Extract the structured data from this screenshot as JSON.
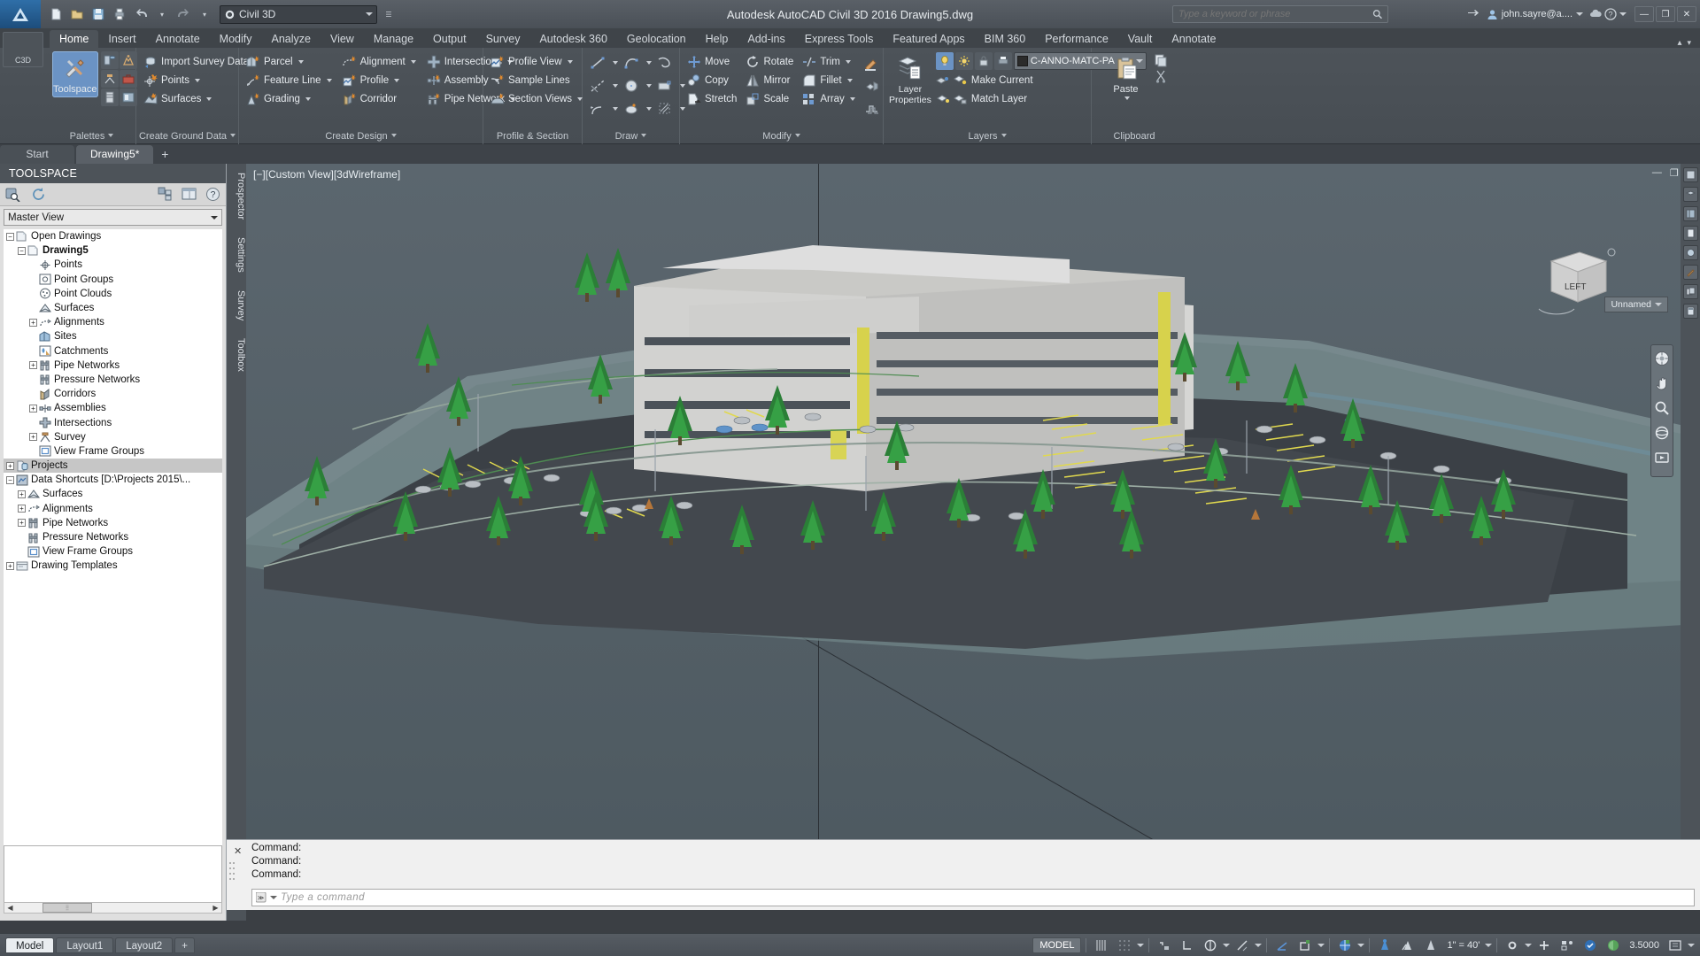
{
  "titlebar": {
    "workspace": "Civil 3D",
    "title": "Autodesk AutoCAD Civil 3D 2016    Drawing5.dwg",
    "search_placeholder": "Type a keyword or phrase",
    "account": "john.sayre@a....",
    "quick_access": [
      "new-icon",
      "open-icon",
      "save-icon",
      "plot-icon",
      "undo-icon",
      "redo-icon"
    ],
    "window_buttons": [
      "minimize",
      "restore",
      "close"
    ]
  },
  "ribbon_tabs": [
    {
      "label": "Home",
      "active": true
    },
    {
      "label": "Insert",
      "active": false
    },
    {
      "label": "Annotate",
      "active": false
    },
    {
      "label": "Modify",
      "active": false
    },
    {
      "label": "Analyze",
      "active": false
    },
    {
      "label": "View",
      "active": false
    },
    {
      "label": "Manage",
      "active": false
    },
    {
      "label": "Output",
      "active": false
    },
    {
      "label": "Survey",
      "active": false
    },
    {
      "label": "Autodesk 360",
      "active": false
    },
    {
      "label": "Geolocation",
      "active": false
    },
    {
      "label": "Help",
      "active": false
    },
    {
      "label": "Add-ins",
      "active": false
    },
    {
      "label": "Express Tools",
      "active": false
    },
    {
      "label": "Featured Apps",
      "active": false
    },
    {
      "label": "BIM 360",
      "active": false
    },
    {
      "label": "Performance",
      "active": false
    },
    {
      "label": "Vault",
      "active": false
    },
    {
      "label": "Annotate",
      "active": false
    }
  ],
  "panels": {
    "palettes": {
      "title": "Palettes",
      "toolspace": "Toolspace"
    },
    "create_ground_data": {
      "title": "Create Ground Data",
      "items": [
        {
          "label": "Import Survey Data",
          "icon": "import-survey-data-icon",
          "dropdown": false
        },
        {
          "label": "Points",
          "icon": "points-icon",
          "dropdown": true
        },
        {
          "label": "Surfaces",
          "icon": "surfaces-icon",
          "dropdown": true
        }
      ]
    },
    "create_design": {
      "title": "Create Design",
      "col1": [
        {
          "label": "Parcel",
          "icon": "parcel-icon",
          "dropdown": true
        },
        {
          "label": "Feature Line",
          "icon": "feature-line-icon",
          "dropdown": true
        },
        {
          "label": "Grading",
          "icon": "grading-icon",
          "dropdown": true
        }
      ],
      "col2": [
        {
          "label": "Alignment",
          "icon": "alignment-icon",
          "dropdown": true
        },
        {
          "label": "Profile",
          "icon": "profile-icon",
          "dropdown": true
        },
        {
          "label": "Corridor",
          "icon": "corridor-icon",
          "dropdown": false
        }
      ],
      "col3": [
        {
          "label": "Intersections",
          "icon": "intersections-icon",
          "dropdown": true
        },
        {
          "label": "Assembly",
          "icon": "assembly-icon",
          "dropdown": true
        },
        {
          "label": "Pipe Network",
          "icon": "pipe-network-icon",
          "dropdown": true
        }
      ]
    },
    "profile_section_views": {
      "title": "Profile & Section Views",
      "items": [
        {
          "label": "Profile View",
          "icon": "profile-view-icon",
          "dropdown": true
        },
        {
          "label": "Sample Lines",
          "icon": "sample-lines-icon",
          "dropdown": false
        },
        {
          "label": "Section Views",
          "icon": "section-views-icon",
          "dropdown": true
        }
      ]
    },
    "draw": {
      "title": "Draw",
      "tools": [
        "line-icon",
        "arc-icon",
        "polyline-icon",
        "spline-icon",
        "circle-icon",
        "rectangle-icon",
        "curve-icon",
        "ellipse-icon",
        "hatch-icon"
      ]
    },
    "modify": {
      "title": "Modify",
      "items": [
        {
          "label": "Move",
          "icon": "move-icon"
        },
        {
          "label": "Rotate",
          "icon": "rotate-icon"
        },
        {
          "label": "Trim",
          "icon": "trim-icon",
          "dropdown": true
        },
        {
          "label": "Copy",
          "icon": "copy-icon"
        },
        {
          "label": "Mirror",
          "icon": "mirror-icon"
        },
        {
          "label": "Fillet",
          "icon": "fillet-icon",
          "dropdown": true
        },
        {
          "label": "Stretch",
          "icon": "stretch-icon"
        },
        {
          "label": "Scale",
          "icon": "scale-icon"
        },
        {
          "label": "Array",
          "icon": "array-icon",
          "dropdown": true
        }
      ],
      "extra_icons": [
        "explode-icon",
        "solid-edit-icon",
        "offset-icon"
      ]
    },
    "layers": {
      "title": "Layers",
      "layer_properties": "Layer\nProperties",
      "layer_properties_label": "Layer Properties",
      "current_layer": "C-ANNO-MATC-PA",
      "layer_color": "#2b2b2b",
      "make_current": "Make Current",
      "match_layer": "Match Layer"
    },
    "clipboard": {
      "title": "Clipboard",
      "paste": "Paste"
    }
  },
  "file_tabs": [
    {
      "label": "Start",
      "active": false
    },
    {
      "label": "Drawing5*",
      "active": true
    }
  ],
  "toolspace": {
    "header": "TOOLSPACE",
    "view_selector": "Master View",
    "toolbar_icons": [
      "search-icon",
      "refresh-icon",
      "panel-layout-icon",
      "panel-preview-icon",
      "help-icon"
    ],
    "tree": [
      {
        "label": "Open Drawings",
        "depth": 0,
        "expander": "minus",
        "icon": "folder-icon",
        "bold": false,
        "selected": false
      },
      {
        "label": "Drawing5",
        "depth": 1,
        "expander": "minus",
        "icon": "drawing-icon",
        "bold": true,
        "selected": false
      },
      {
        "label": "Points",
        "depth": 2,
        "expander": "none",
        "icon": "points-node-icon",
        "bold": false,
        "selected": false
      },
      {
        "label": "Point Groups",
        "depth": 2,
        "expander": "none",
        "icon": "point-groups-icon",
        "bold": false,
        "selected": false
      },
      {
        "label": "Point Clouds",
        "depth": 2,
        "expander": "none",
        "icon": "point-clouds-icon",
        "bold": false,
        "selected": false
      },
      {
        "label": "Surfaces",
        "depth": 2,
        "expander": "none",
        "icon": "surfaces-node-icon",
        "bold": false,
        "selected": false
      },
      {
        "label": "Alignments",
        "depth": 2,
        "expander": "plus",
        "icon": "alignments-node-icon",
        "bold": false,
        "selected": false
      },
      {
        "label": "Sites",
        "depth": 2,
        "expander": "none",
        "icon": "sites-icon",
        "bold": false,
        "selected": false
      },
      {
        "label": "Catchments",
        "depth": 2,
        "expander": "none",
        "icon": "catchments-icon",
        "bold": false,
        "selected": false
      },
      {
        "label": "Pipe Networks",
        "depth": 2,
        "expander": "plus",
        "icon": "pipe-networks-icon",
        "bold": false,
        "selected": false
      },
      {
        "label": "Pressure Networks",
        "depth": 2,
        "expander": "none",
        "icon": "pressure-networks-icon",
        "bold": false,
        "selected": false
      },
      {
        "label": "Corridors",
        "depth": 2,
        "expander": "none",
        "icon": "corridors-icon",
        "bold": false,
        "selected": false
      },
      {
        "label": "Assemblies",
        "depth": 2,
        "expander": "plus",
        "icon": "assemblies-icon",
        "bold": false,
        "selected": false
      },
      {
        "label": "Intersections",
        "depth": 2,
        "expander": "none",
        "icon": "intersections-node-icon",
        "bold": false,
        "selected": false
      },
      {
        "label": "Survey",
        "depth": 2,
        "expander": "plus",
        "icon": "survey-icon",
        "bold": false,
        "selected": false
      },
      {
        "label": "View Frame Groups",
        "depth": 2,
        "expander": "none",
        "icon": "view-frame-groups-icon",
        "bold": false,
        "selected": false
      },
      {
        "label": "Projects",
        "depth": 0,
        "expander": "plus",
        "icon": "projects-icon",
        "bold": false,
        "selected": true
      },
      {
        "label": "Data Shortcuts [D:\\Projects 2015\\...",
        "depth": 0,
        "expander": "minus",
        "icon": "data-shortcuts-icon",
        "bold": false,
        "selected": false
      },
      {
        "label": "Surfaces",
        "depth": 1,
        "expander": "plus",
        "icon": "surfaces-node-icon",
        "bold": false,
        "selected": false
      },
      {
        "label": "Alignments",
        "depth": 1,
        "expander": "plus",
        "icon": "alignments-node-icon",
        "bold": false,
        "selected": false
      },
      {
        "label": "Pipe Networks",
        "depth": 1,
        "expander": "plus",
        "icon": "pipe-networks-icon",
        "bold": false,
        "selected": false
      },
      {
        "label": "Pressure Networks",
        "depth": 1,
        "expander": "none",
        "icon": "pressure-networks-icon",
        "bold": false,
        "selected": false
      },
      {
        "label": "View Frame Groups",
        "depth": 1,
        "expander": "none",
        "icon": "view-frame-groups-icon",
        "bold": false,
        "selected": false
      },
      {
        "label": "Drawing Templates",
        "depth": 0,
        "expander": "plus",
        "icon": "templates-icon",
        "bold": false,
        "selected": false
      }
    ],
    "side_tabs": [
      "Prospector",
      "Settings",
      "Survey",
      "Toolbox"
    ]
  },
  "viewport": {
    "label": "[−][Custom View][3dWireframe]",
    "viewcube_face": "LEFT",
    "unnamed_view": "Unnamed"
  },
  "command_line": {
    "history": [
      "Command:",
      "Command:",
      "Command:"
    ],
    "placeholder": "Type a command",
    "prompt": "≫"
  },
  "status_bar": {
    "layout_tabs": [
      {
        "label": "Model",
        "active": true
      },
      {
        "label": "Layout1",
        "active": false
      },
      {
        "label": "Layout2",
        "active": false
      }
    ],
    "add_layout": "+",
    "model_button": "MODEL",
    "annotation_scale": "1\" = 40'",
    "lineweight_value": "3.5000",
    "icons": [
      "grid-display-icon",
      "snap-mode-icon",
      "infer-constraints-icon",
      "ortho-mode-icon",
      "polar-tracking-icon",
      "object-snap-icon",
      "osnap-tracking-icon",
      "ucs-icon",
      "annotation-visibility-icon",
      "autoscale-icon",
      "annotation-monitor-icon",
      "workspace-switch-icon",
      "hardware-accel-icon",
      "isolate-objects-icon",
      "clean-screen-icon"
    ]
  }
}
